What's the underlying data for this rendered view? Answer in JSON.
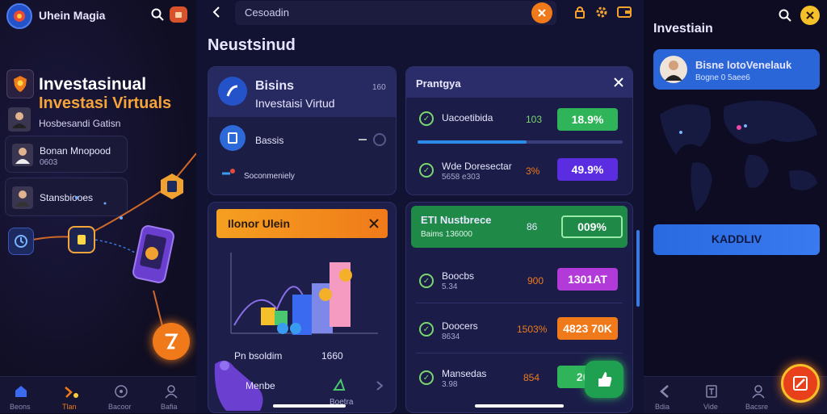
{
  "left": {
    "app_title": "Uhein Magia",
    "hero_line1": "Investasinual",
    "hero_line2": "Investasi Virtuals",
    "hero_sub": "Hosbesandi Gatisn",
    "items": [
      {
        "title": "Bonan Mnopood",
        "sub": "0603"
      },
      {
        "title": "Stansbiooes",
        "sub": ""
      }
    ],
    "nav": [
      "Beons",
      "Tlan",
      "Bacoor",
      "Bafia"
    ]
  },
  "mid": {
    "search_text": "Cesoadin",
    "page_title": "Neustsinud",
    "card1": {
      "title": "Bisins",
      "subtitle": "Investaisi Virtud",
      "badge": "160",
      "item": "Bassis",
      "link": "Soconmeniely"
    },
    "card2": {
      "title": "Prantgya",
      "rows": [
        {
          "name": "Uacoetibida",
          "sub": "",
          "val": "103",
          "pill": "18.9%",
          "color": "#2fb45a"
        },
        {
          "name": "Wde Doresectar",
          "sub": "5658 e303",
          "val": "3%",
          "pill": "49.9%",
          "color": "#5a2ee0"
        }
      ]
    },
    "card3": {
      "header": "Ilonor Ulein",
      "footer_label": "Pn bsoldim",
      "footer_value": "1660"
    },
    "card4": {
      "banner_title": "ETI Nustbrece",
      "banner_sub": "Baims 136000",
      "banner_val": "86",
      "banner_pill": "009%",
      "rows": [
        {
          "name": "Boocbs",
          "sub": "5.34",
          "val": "900",
          "pill": "1301AT",
          "color": "#b23ad8"
        },
        {
          "name": "Doocers",
          "sub": "8634",
          "val": "1503%",
          "pill": "4823 70K",
          "color": "#f07a1a"
        },
        {
          "name": "Mansedas",
          "sub": "3.98",
          "val": "854",
          "pill": "26.3",
          "color": "#2fb45a"
        }
      ]
    },
    "bottom": {
      "label1": "Menbe",
      "label2": "Boetra"
    }
  },
  "right": {
    "title": "Investiain",
    "profile_name": "Bisne lotoVenelauk",
    "profile_sub": "Bogne 0 5aee6",
    "cta": "KADDLIV",
    "nav": [
      "Bdia",
      "Vide",
      "Bacsre"
    ]
  },
  "colors": {
    "accent_orange": "#f07a1a",
    "accent_blue": "#2d6ad8",
    "green": "#2fb45a",
    "purple": "#5a2ee0"
  }
}
